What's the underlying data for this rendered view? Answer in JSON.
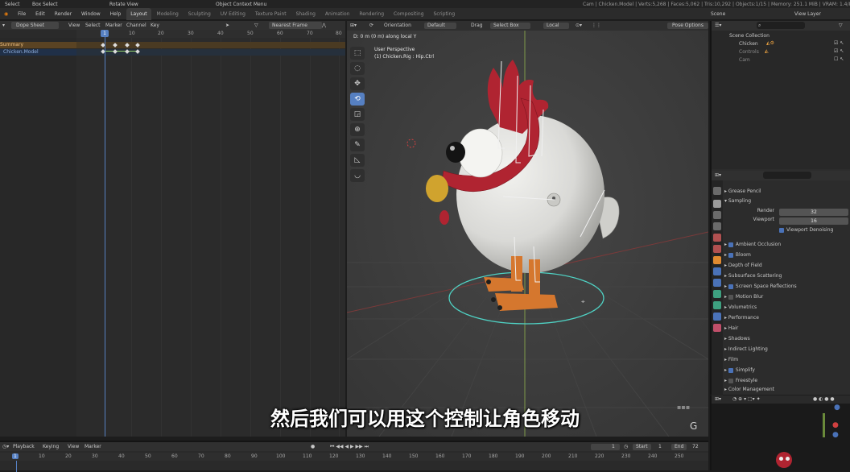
{
  "topbar": {
    "select_label": "Select",
    "box_select_label": "Box Select",
    "rotate_view_label": "Rotate View",
    "context_menu_label": "Object Context Menu",
    "status_text": "Cam | Chicken.Model | Verts:5,268 | Faces:5,062 | Tris:10,292 | Objects:1/15 | Memory: 251.1 MiB | VRAM: 1.4/8.0 GiB | 2.91"
  },
  "menu": {
    "items": [
      "File",
      "Edit",
      "Render",
      "Window",
      "Help"
    ],
    "workspaces": [
      "Layout",
      "Modeling",
      "Sculpting",
      "UV Editing",
      "Texture Paint",
      "Shading",
      "Animation",
      "Rendering",
      "Compositing",
      "Scripting"
    ],
    "scene_label": "Scene",
    "view_layer_label": "View Layer"
  },
  "dope_sheet": {
    "mode": "Dope Sheet",
    "menus": [
      "View",
      "Select",
      "Marker",
      "Channel",
      "Key"
    ],
    "snap": "Nearest Frame",
    "current_frame": "1",
    "ruler_ticks": [
      "10",
      "20",
      "30",
      "40",
      "50",
      "60",
      "70",
      "80"
    ],
    "channels": [
      "Summary",
      "Chicken.Model"
    ]
  },
  "viewport": {
    "header": {
      "orientation_label": "Orientation",
      "orientation_value": "Default",
      "drag_label": "Drag",
      "drag_value": "Select Box",
      "pivot_label": "Local",
      "pose_options": "Pose Options"
    },
    "status_line": "D: 0 m (0 m) along local Y",
    "perspective": "User Perspective",
    "active_object": "(1) Chicken.Rig : Hip.Ctrl",
    "tools": [
      "select-box",
      "cursor",
      "move",
      "rotate",
      "scale",
      "transform",
      "annotate",
      "measure",
      "bend"
    ],
    "active_tool": "rotate",
    "nav_label": "G"
  },
  "outliner": {
    "title": "Scene Collection",
    "items": [
      "Chicken",
      "Controls",
      "Cam"
    ]
  },
  "properties": {
    "sections": [
      {
        "label": "Grease Pencil",
        "checkbox": null
      },
      {
        "label": "Sampling",
        "checkbox": null,
        "expanded": true
      },
      {
        "label": "Ambient Occlusion",
        "checkbox": true
      },
      {
        "label": "Bloom",
        "checkbox": true
      },
      {
        "label": "Depth of Field",
        "checkbox": null
      },
      {
        "label": "Subsurface Scattering",
        "checkbox": null
      },
      {
        "label": "Screen Space Reflections",
        "checkbox": true
      },
      {
        "label": "Motion Blur",
        "checkbox": false
      },
      {
        "label": "Volumetrics",
        "checkbox": null
      },
      {
        "label": "Performance",
        "checkbox": null
      },
      {
        "label": "Hair",
        "checkbox": null
      },
      {
        "label": "Shadows",
        "checkbox": null
      },
      {
        "label": "Indirect Lighting",
        "checkbox": null
      },
      {
        "label": "Film",
        "checkbox": null
      },
      {
        "label": "Simplify",
        "checkbox": true
      },
      {
        "label": "Freestyle",
        "checkbox": false
      },
      {
        "label": "Color Management",
        "checkbox": null
      }
    ],
    "sampling": {
      "render_label": "Render",
      "render_value": "32",
      "viewport_label": "Viewport",
      "viewport_value": "16",
      "denoise_label": "Viewport Denoising"
    }
  },
  "timeline": {
    "menus": [
      "Playback",
      "Keying",
      "View",
      "Marker"
    ],
    "current_frame": "1",
    "start_label": "Start",
    "start_value": "1",
    "end_label": "End",
    "end_value": "72",
    "ruler_ticks": [
      "10",
      "20",
      "30",
      "40",
      "50",
      "60",
      "70",
      "80",
      "90",
      "100",
      "110",
      "120",
      "130",
      "140",
      "150",
      "160",
      "170",
      "180",
      "190",
      "200",
      "210",
      "220",
      "230",
      "240",
      "250"
    ]
  },
  "subtitle": "然后我们可以用这个控制让角色移动",
  "colors": {
    "accent": "#5680c2",
    "chicken_body": "#d9d9d6",
    "comb": "#b02431",
    "beak": "#d0a32e",
    "legs": "#d5772e"
  }
}
